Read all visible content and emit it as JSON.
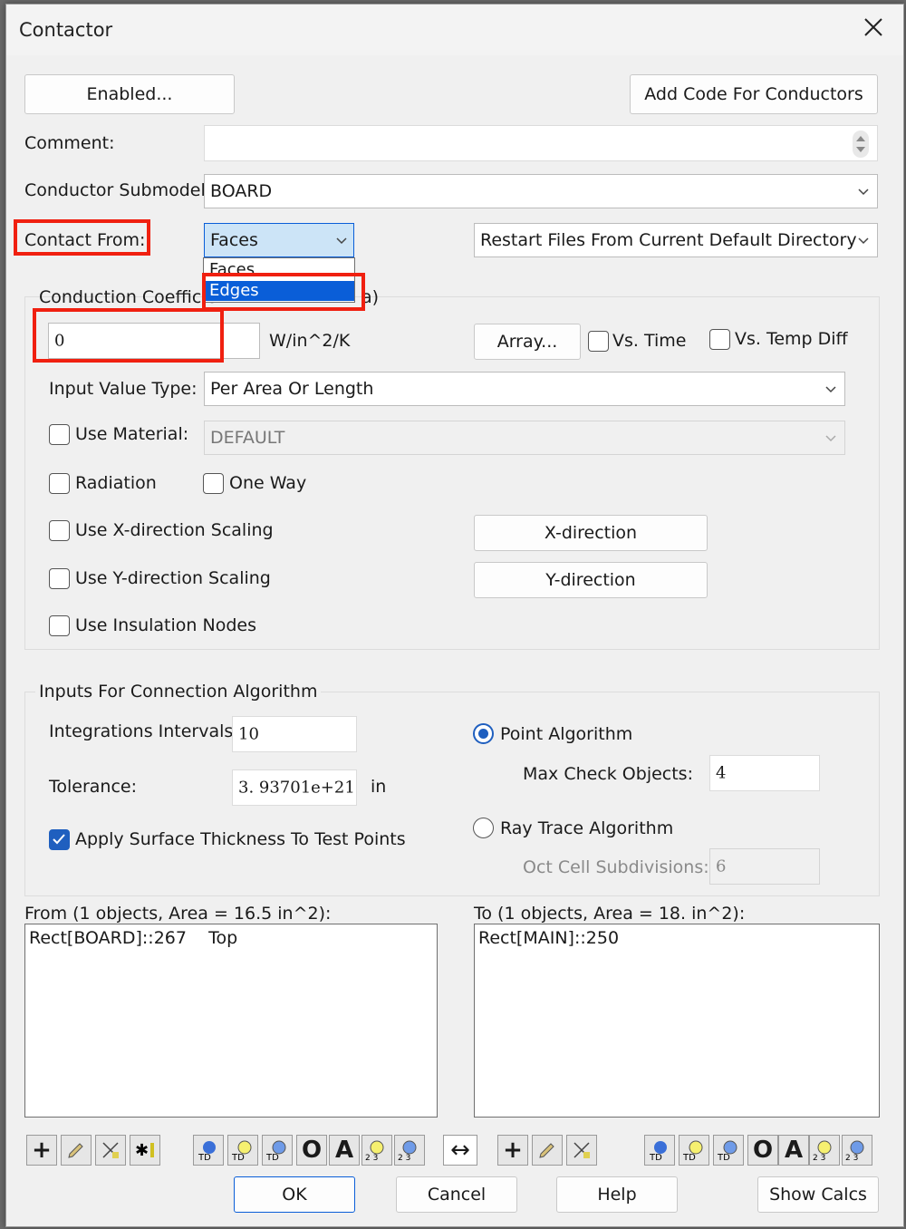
{
  "window": {
    "title": "Contactor"
  },
  "buttons": {
    "enabled": "Enabled...",
    "add_code": "Add Code For Conductors",
    "array": "Array...",
    "x_direction": "X-direction",
    "y_direction": "Y-direction",
    "ok": "OK",
    "cancel": "Cancel",
    "help": "Help",
    "show_calcs": "Show Calcs"
  },
  "labels": {
    "comment": "Comment:",
    "conductor_submodel": "Conductor Submodel:",
    "contact_from": "Contact From:",
    "conduction_coefficient": "Conduction Coefficie",
    "conduction_coefficient_tail": "a)",
    "units": "W/in^2/K",
    "input_value_type": "Input Value Type:",
    "integration_intervals": "Integrations Intervals:",
    "tolerance": "Tolerance:",
    "tolerance_unit": "in",
    "max_check_objects": "Max Check Objects:",
    "oct_cell": "Oct Cell Subdivisions:",
    "inputs_group": "Inputs For Connection Algorithm",
    "from_header": "From (1 objects, Area = 16.5 in^2):",
    "to_header": "To (1 objects, Area = 18. in^2):"
  },
  "fields": {
    "comment_value": "",
    "conductor_submodel": "BOARD",
    "contact_from": "Faces",
    "restart_files": "Restart Files From Current Default Directory",
    "conduction_value": "0",
    "input_value_type": "Per Area Or Length",
    "material": "DEFAULT",
    "integration_intervals": "10",
    "tolerance": "3. 93701e+21",
    "max_check_objects": "4",
    "oct_cell": "6"
  },
  "dropdown": {
    "options": [
      "Faces",
      "Edges"
    ],
    "selected": "Edges"
  },
  "checkboxes": {
    "vs_time": {
      "label": "Vs. Time",
      "checked": false
    },
    "vs_temp_diff": {
      "label": "Vs. Temp Diff",
      "checked": false
    },
    "use_material": {
      "label": "Use Material:",
      "checked": false
    },
    "radiation": {
      "label": "Radiation",
      "checked": false
    },
    "one_way": {
      "label": "One Way",
      "checked": false
    },
    "x_scaling": {
      "label": "Use X-direction Scaling",
      "checked": false
    },
    "y_scaling": {
      "label": "Use Y-direction Scaling",
      "checked": false
    },
    "insulation": {
      "label": "Use Insulation Nodes",
      "checked": false
    },
    "apply_thickness": {
      "label": "Apply Surface Thickness To Test Points",
      "checked": true
    }
  },
  "radios": {
    "point": {
      "label": "Point Algorithm",
      "selected": true
    },
    "ray_trace": {
      "label": "Ray Trace Algorithm",
      "selected": false
    }
  },
  "lists": {
    "from_items": "Rect[BOARD]::267    Top",
    "to_items": "Rect[MAIN]::250"
  },
  "toolbar": {
    "swap_glyph": "↔"
  },
  "colors": {
    "accent": "#1f5fbf",
    "highlight": "#f02010",
    "selection": "#0a5ed8"
  }
}
